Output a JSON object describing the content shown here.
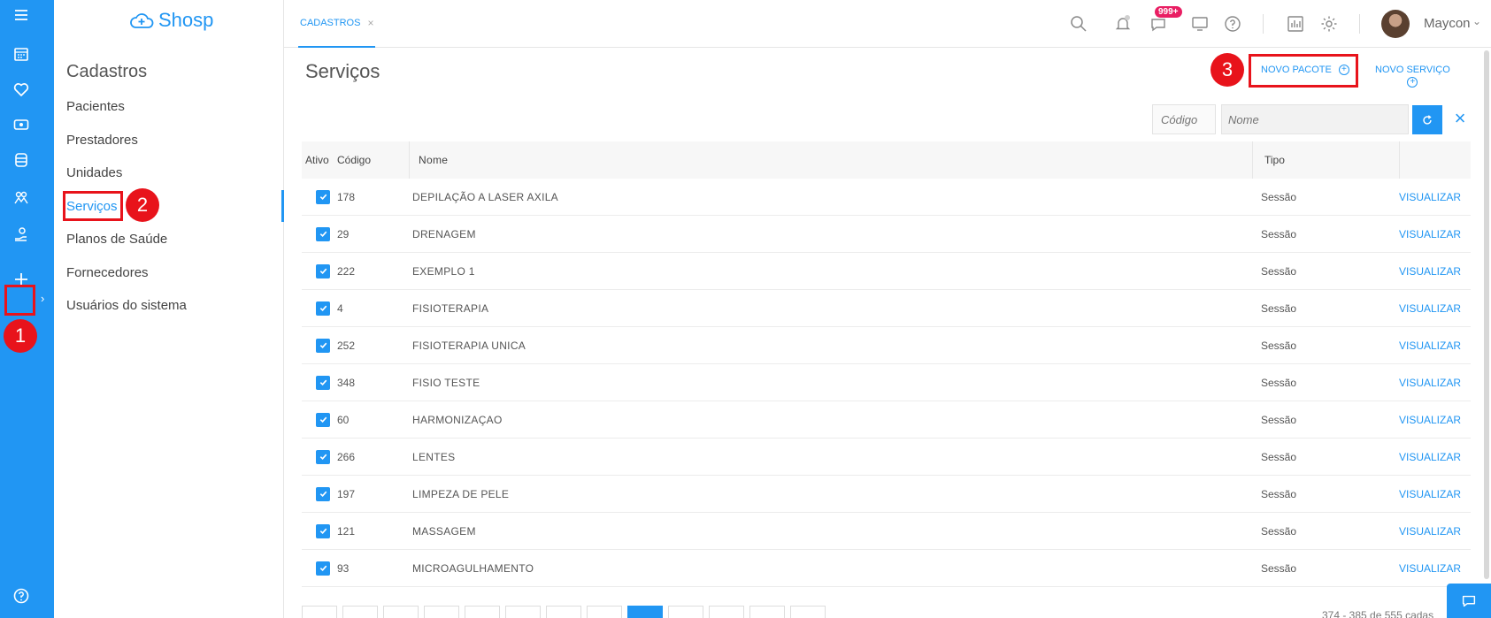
{
  "brand": {
    "name": "Shosp",
    "color": "#2196f3"
  },
  "rail": {
    "icons": [
      "menu-icon",
      "calendar-icon",
      "heart-icon",
      "money-icon",
      "database-icon",
      "group-icon",
      "hand-care-icon",
      "plus-icon",
      "help-icon"
    ]
  },
  "sidebar": {
    "title": "Cadastros",
    "items": [
      {
        "label": "Pacientes"
      },
      {
        "label": "Prestadores"
      },
      {
        "label": "Unidades"
      },
      {
        "label": "Serviços"
      },
      {
        "label": "Planos de Saúde"
      },
      {
        "label": "Fornecedores"
      },
      {
        "label": "Usuários do sistema"
      }
    ]
  },
  "annotations": {
    "step1": "1",
    "step2": "2",
    "step3": "3",
    "color": "#e8131b"
  },
  "topbar": {
    "tab_label": "CADASTROS",
    "tab_close": "×",
    "badge": "999+",
    "user_name": "Maycon"
  },
  "main": {
    "title": "Serviços",
    "new_package": "NOVO PACOTE",
    "new_service": "NOVO SERVIÇO",
    "filter_code_placeholder": "Código",
    "filter_name_placeholder": "Nome",
    "columns": {
      "ativo": "Ativo",
      "codigo": "Código",
      "nome": "Nome",
      "tipo": "Tipo"
    },
    "rows": [
      {
        "codigo": "178",
        "nome": "DEPILAÇÃO A LASER AXILA",
        "tipo": "Sessão",
        "acao": "VISUALIZAR"
      },
      {
        "codigo": "29",
        "nome": "DRENAGEM",
        "tipo": "Sessão",
        "acao": "VISUALIZAR"
      },
      {
        "codigo": "222",
        "nome": "EXEMPLO 1",
        "tipo": "Sessão",
        "acao": "VISUALIZAR"
      },
      {
        "codigo": "4",
        "nome": "FISIOTERAPIA",
        "tipo": "Sessão",
        "acao": "VISUALIZAR"
      },
      {
        "codigo": "252",
        "nome": "FISIOTERAPIA UNICA",
        "tipo": "Sessão",
        "acao": "VISUALIZAR"
      },
      {
        "codigo": "348",
        "nome": "FISIO TESTE",
        "tipo": "Sessão",
        "acao": "VISUALIZAR"
      },
      {
        "codigo": "60",
        "nome": "HARMONIZAÇAO",
        "tipo": "Sessão",
        "acao": "VISUALIZAR"
      },
      {
        "codigo": "266",
        "nome": "LENTES",
        "tipo": "Sessão",
        "acao": "VISUALIZAR"
      },
      {
        "codigo": "197",
        "nome": "LIMPEZA DE PELE",
        "tipo": "Sessão",
        "acao": "VISUALIZAR"
      },
      {
        "codigo": "121",
        "nome": "MASSAGEM",
        "tipo": "Sessão",
        "acao": "VISUALIZAR"
      },
      {
        "codigo": "93",
        "nome": "MICROAGULHAMENTO",
        "tipo": "Sessão",
        "acao": "VISUALIZAR"
      }
    ],
    "pagination_info": "374 - 385 de 555 cadas"
  }
}
